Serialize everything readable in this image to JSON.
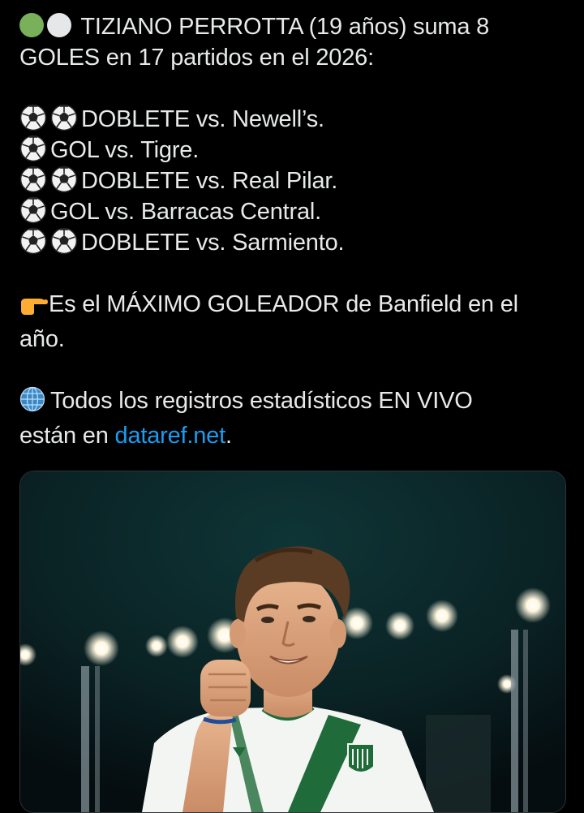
{
  "tweet": {
    "intro_line1": "TIZIANO PERROTTA (19 años) suma 8",
    "intro_line2": "GOLES en 17 partidos en el 2026:",
    "goals": [
      {
        "text": "DOBLETE vs. Newell’s.",
        "balls": 2
      },
      {
        "text": "GOL vs. Tigre.",
        "balls": 1
      },
      {
        "text": "DOBLETE vs. Real Pilar.",
        "balls": 2
      },
      {
        "text": "GOL vs. Barracas Central.",
        "balls": 1
      },
      {
        "text": "DOBLETE vs. Sarmiento.",
        "balls": 2
      }
    ],
    "top_scorer_line1": "Es el MÁXIMO GOLEADOR de Banfield en el",
    "top_scorer_line2": "año.",
    "stats_line1": "Todos los registros estadísticos EN VIVO",
    "stats_prefix": "están en ",
    "stats_link": "dataref.net",
    "stats_suffix": "."
  },
  "media": {
    "icons": [
      "green-circle-icon",
      "white-circle-icon",
      "soccer-ball-icon",
      "pointing-right-icon",
      "globe-icon"
    ],
    "colors": {
      "background": "#000000",
      "text": "#e7e9ea",
      "link": "#1d9bf0",
      "kit_green": "#1f6b3a"
    }
  }
}
